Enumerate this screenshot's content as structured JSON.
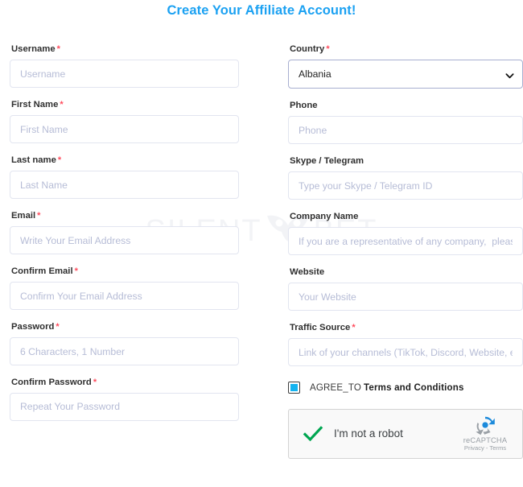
{
  "page": {
    "title": "Create Your Affiliate Account!",
    "watermark_left": "SILENT",
    "watermark_right": "BET",
    "accent_color": "#1ba1f2",
    "required_marker": "*"
  },
  "form": {
    "left_column": [
      {
        "name": "username",
        "label": "Username",
        "required": true,
        "placeholder": "Username",
        "value": ""
      },
      {
        "name": "first-name",
        "label": "First Name",
        "required": true,
        "placeholder": "First Name",
        "value": ""
      },
      {
        "name": "last-name",
        "label": "Last name",
        "required": true,
        "placeholder": "Last Name",
        "value": ""
      },
      {
        "name": "email",
        "label": "Email",
        "required": true,
        "placeholder": "Write Your Email Address",
        "value": ""
      },
      {
        "name": "confirm-email",
        "label": "Confirm Email",
        "required": true,
        "placeholder": "Confirm Your Email Address",
        "value": ""
      },
      {
        "name": "password",
        "label": "Password",
        "required": true,
        "placeholder": "6 Characters, 1 Number",
        "value": ""
      },
      {
        "name": "confirm-password",
        "label": "Confirm Password",
        "required": true,
        "placeholder": "Repeat Your Password",
        "value": ""
      }
    ],
    "right_column": [
      {
        "name": "country",
        "label": "Country",
        "required": true,
        "type": "select",
        "selected": "Albania",
        "icon": "chevron-down-icon"
      },
      {
        "name": "phone",
        "label": "Phone",
        "required": false,
        "placeholder": "Phone",
        "value": ""
      },
      {
        "name": "skype-telegram",
        "label": "Skype / Telegram",
        "required": false,
        "placeholder": "Type your Skype / Telegram ID",
        "value": ""
      },
      {
        "name": "company-name",
        "label": "Company Name",
        "required": false,
        "placeholder": "If you are a representative of any company,  please write",
        "value": ""
      },
      {
        "name": "website",
        "label": "Website",
        "required": false,
        "placeholder": "Your Website",
        "value": ""
      },
      {
        "name": "traffic-source",
        "label": "Traffic Source",
        "required": true,
        "placeholder": "Link of your channels (TikTok, Discord, Website, etc)",
        "value": ""
      }
    ]
  },
  "terms": {
    "checked": true,
    "checkbox_color": "#14b3f0",
    "prefix_label": "AGREE_TO",
    "link_label": "Terms and Conditions"
  },
  "recaptcha": {
    "checked": true,
    "check_color": "#00a651",
    "label": "I'm not a robot",
    "brand": "reCAPTCHA",
    "legal": "Privacy - Terms"
  }
}
